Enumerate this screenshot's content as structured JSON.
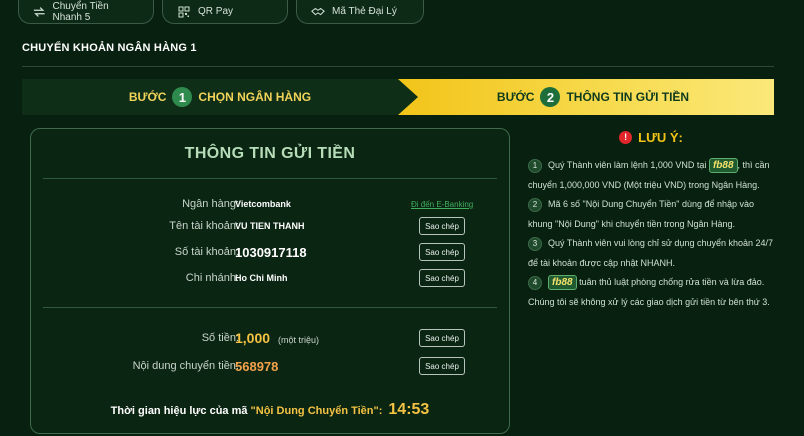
{
  "tabs": [
    {
      "label": "Chuyển Tiền Nhanh 5",
      "icon": "transfer-icon"
    },
    {
      "label": "QR Pay",
      "icon": "qr-code-icon"
    },
    {
      "label": "Mã Thẻ Đại Lý",
      "icon": "handshake-icon"
    }
  ],
  "section_title": "CHUYỂN KHOẢN NGÂN HÀNG 1",
  "steps": [
    {
      "prefix": "BƯỚC",
      "num": "1",
      "label": "CHỌN NGÂN HÀNG"
    },
    {
      "prefix": "BƯỚC",
      "num": "2",
      "label": "THÔNG TIN GỬI TIỀN"
    }
  ],
  "panel": {
    "title": "THÔNG TIN GỬI TIỀN",
    "bank_label": "Ngân hàng:",
    "bank_value": "Vietcombank",
    "ebanking_link": "Đi đến E-Banking",
    "account_name_label": "Tên tài khoản:",
    "account_name_value": "VU TIEN THANH",
    "account_number_label": "Số tài khoản:",
    "account_number_value": "1030917118",
    "branch_label": "Chi nhánh:",
    "branch_value": "Ho Chi Minh",
    "amount_label": "Số tiền:",
    "amount_value": "1,000",
    "amount_unit": "(một triệu)",
    "content_label": "Nội dung chuyển tiền:",
    "content_value": "568978",
    "copy_label": "Sao chép",
    "timer_text": "Thời gian hiệu lực của mã ",
    "timer_code": "\"Nội Dung Chuyển Tiền\":",
    "timer_value": "14:53"
  },
  "notes": {
    "title": "LƯU Ý:",
    "brand": "fb88",
    "items": [
      {
        "num": "1",
        "before": "Quý Thành viên làm lệnh 1,000 VND tại ",
        "after": ", thì cần chuyển 1,000,000 VND (Một triệu VND) trong Ngân Hàng."
      },
      {
        "num": "2",
        "text": "Mã 6 số \"Nội Dung Chuyển Tiền\" dùng để nhập vào khung \"Nội Dung\" khi chuyển tiền trong Ngân Hàng."
      },
      {
        "num": "3",
        "text": "Quý Thành viên vui lòng chỉ sử dụng chuyển khoản 24/7 để tài khoản được cập nhật NHANH."
      },
      {
        "num": "4",
        "after": " tuân thủ luật phòng chống rửa tiền và lừa đảo. Chúng tôi sẽ không xử lý các giao dịch gửi tiền từ bên thứ 3."
      }
    ]
  },
  "colors": {
    "accent": "#f2c418",
    "background": "#08200f",
    "primary_green": "#2f8a4e"
  }
}
